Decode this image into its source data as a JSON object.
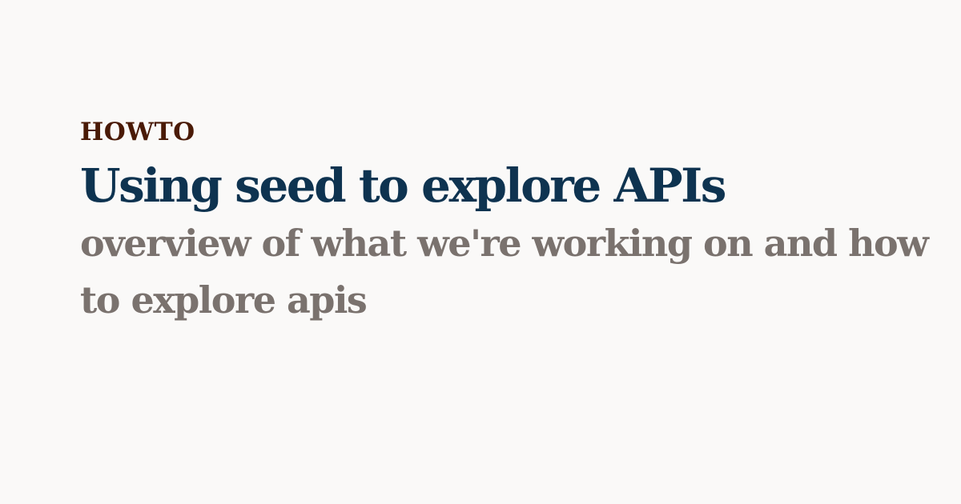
{
  "card": {
    "category": "HOWTO",
    "title": "Using seed to explore APIs",
    "subtitle": "overview of what we're working on and how to explore apis"
  },
  "colors": {
    "background": "#faf9f8",
    "category": "#4a1a06",
    "title": "#0e3350",
    "subtitle": "#7a726e"
  }
}
